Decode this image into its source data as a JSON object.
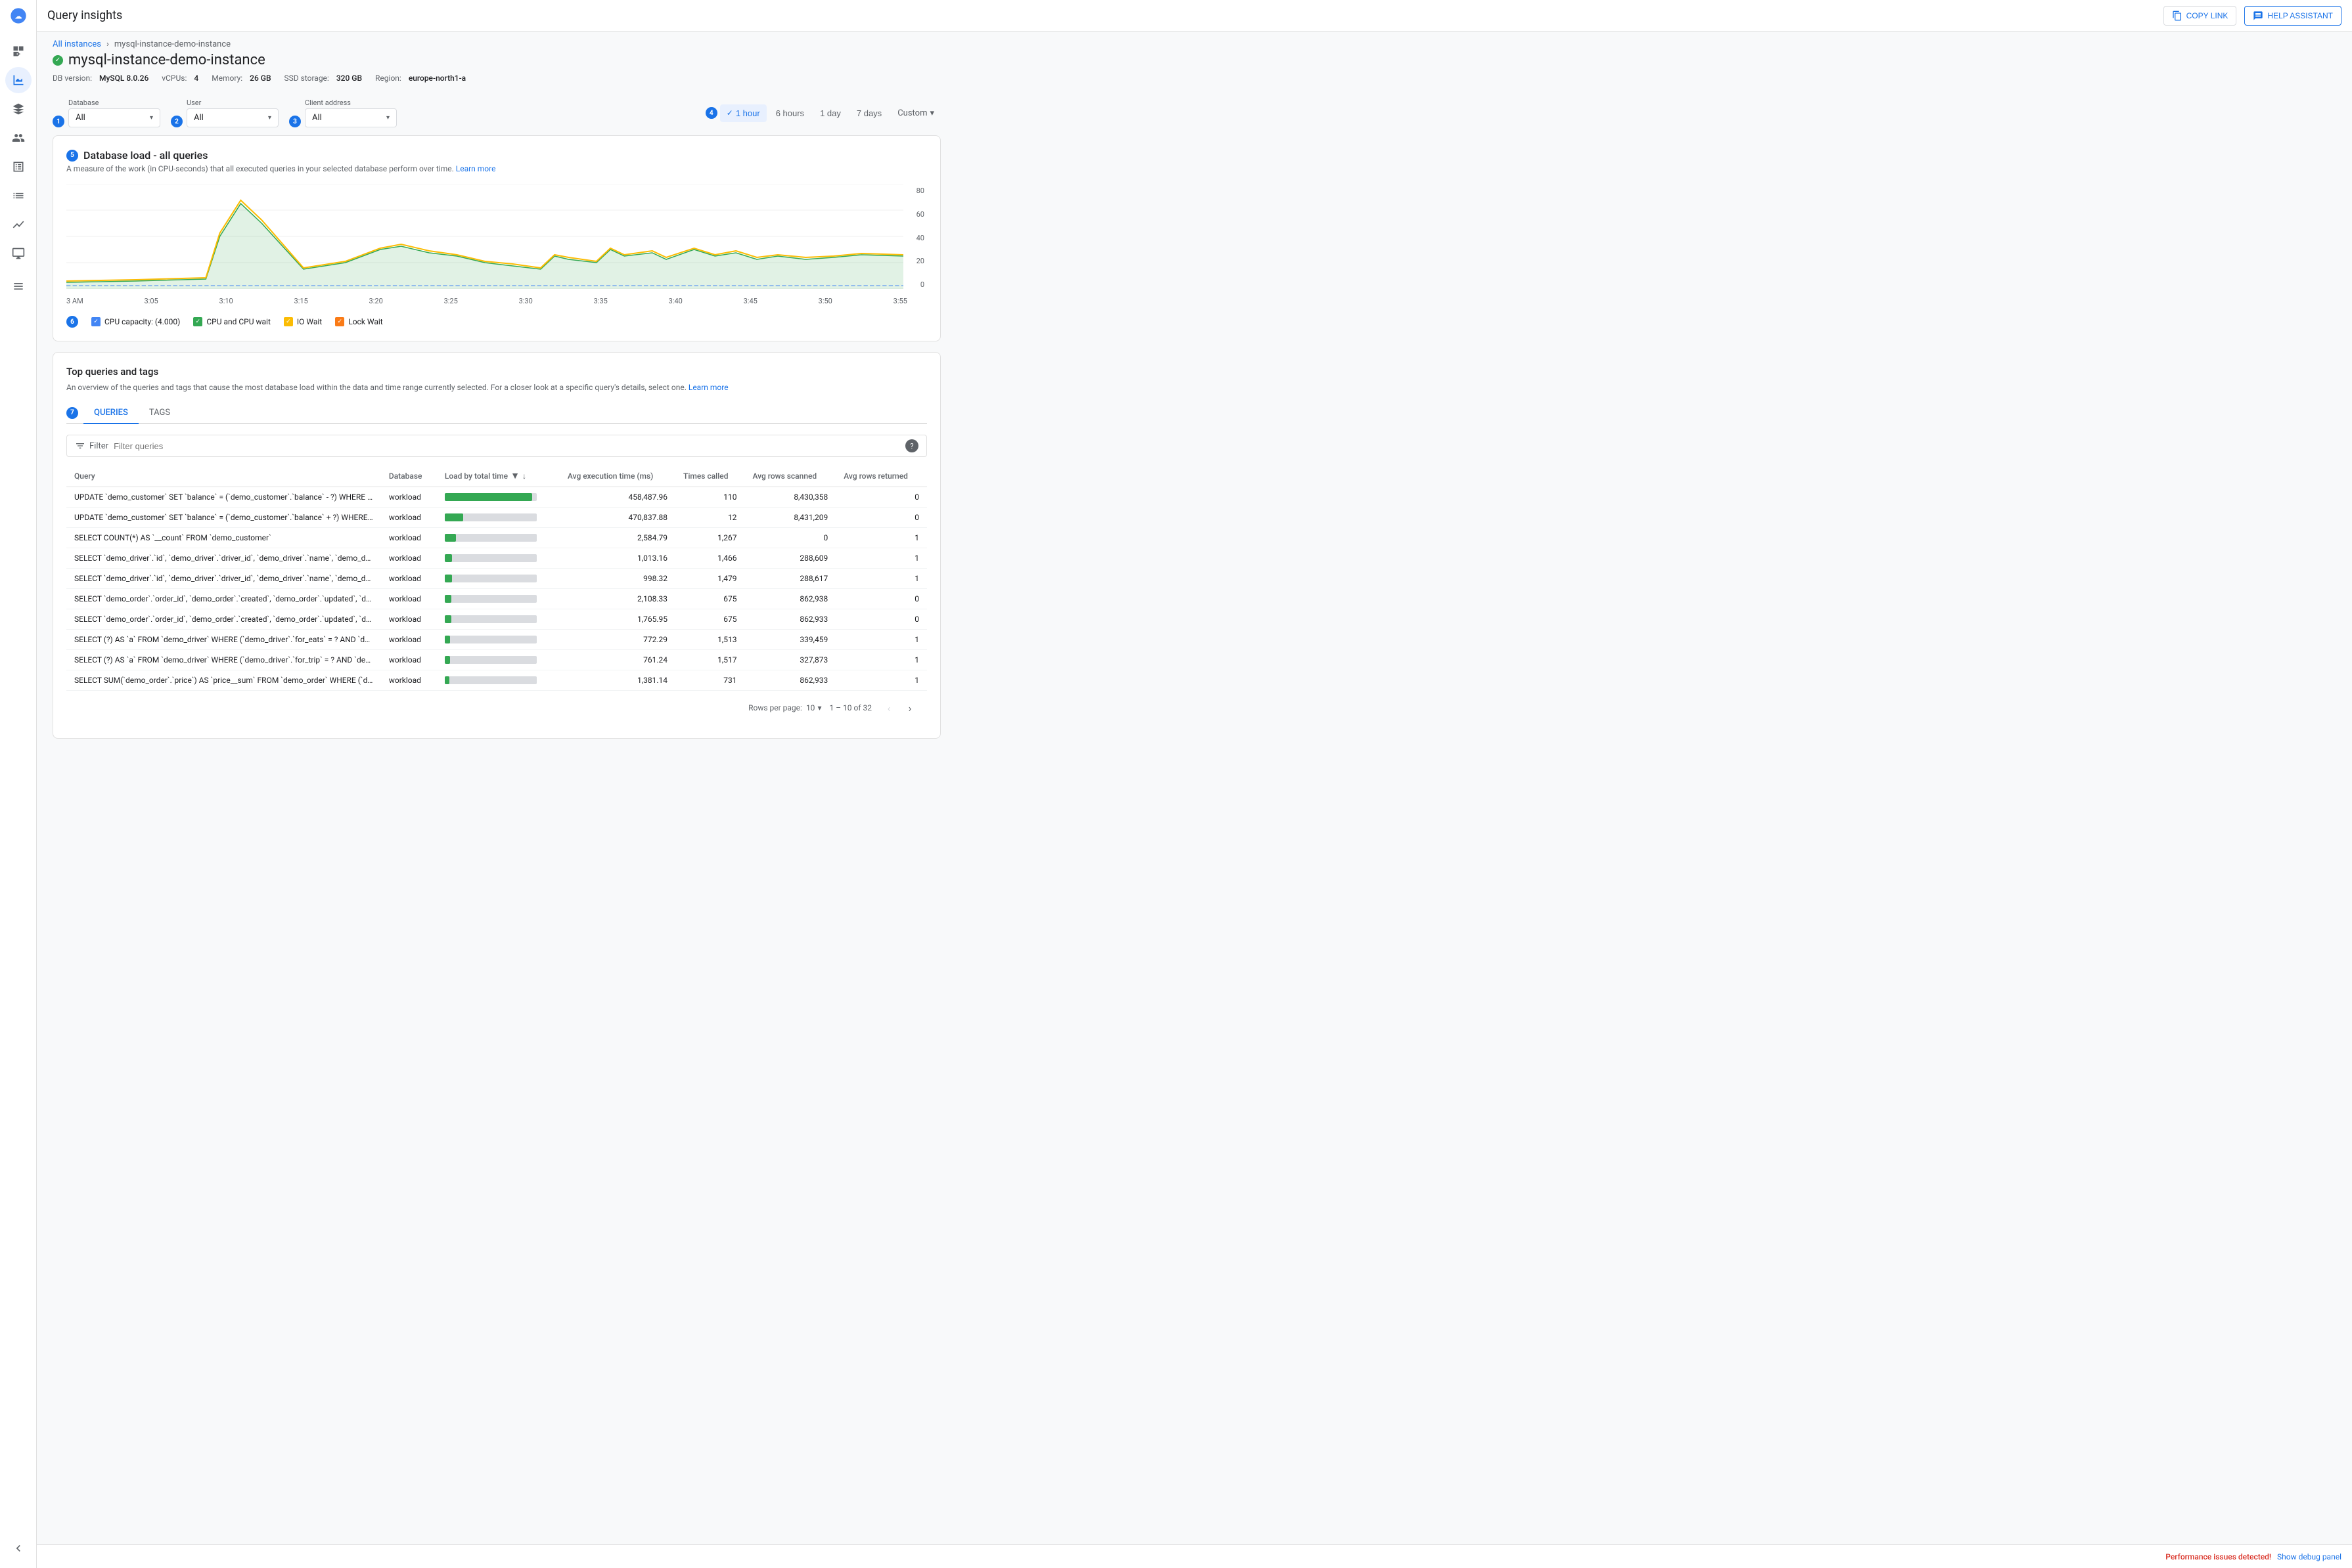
{
  "topbar": {
    "title": "Query insights",
    "copy_link": "COPY LINK",
    "help_assistant": "HELP ASSISTANT"
  },
  "breadcrumb": {
    "all_instances": "All instances",
    "current": "mysql-instance-demo-instance"
  },
  "instance": {
    "name": "mysql-instance-demo-instance",
    "db_version_label": "DB version:",
    "db_version": "MySQL 8.0.26",
    "vcpus_label": "vCPUs:",
    "vcpus": "4",
    "memory_label": "Memory:",
    "memory": "26 GB",
    "ssd_label": "SSD storage:",
    "ssd": "320 GB",
    "region_label": "Region:",
    "region": "europe-north1-a"
  },
  "filters": {
    "database_label": "Database",
    "database_value": "All",
    "user_label": "User",
    "user_value": "All",
    "client_label": "Client address",
    "client_value": "All"
  },
  "time_range": {
    "options": [
      "1 hour",
      "6 hours",
      "1 day",
      "7 days",
      "Custom"
    ],
    "active": "1 hour"
  },
  "chart": {
    "title": "Database load - all queries",
    "desc": "A measure of the work (in CPU-seconds) that all executed queries in your selected database perform over time.",
    "learn_more": "Learn more",
    "y_labels": [
      "80",
      "60",
      "40",
      "20",
      "0"
    ],
    "x_labels": [
      "3 AM",
      "3:05",
      "3:10",
      "3:15",
      "3:20",
      "3:25",
      "3:30",
      "3:35",
      "3:40",
      "3:45",
      "3:50",
      "3:55"
    ],
    "legend": [
      {
        "id": "cpu_capacity",
        "label": "CPU capacity: (4.000)",
        "color": "#4285f4",
        "checked": true,
        "type": "line"
      },
      {
        "id": "cpu_cpu_wait",
        "label": "CPU and CPU wait",
        "color": "#34a853",
        "checked": true,
        "type": "area"
      },
      {
        "id": "io_wait",
        "label": "IO Wait",
        "color": "#fbbc04",
        "checked": true,
        "type": "area"
      },
      {
        "id": "lock_wait",
        "label": "Lock Wait",
        "color": "#fa7b17",
        "checked": true,
        "type": "area"
      }
    ]
  },
  "queries_section": {
    "title": "Top queries and tags",
    "desc": "An overview of the queries and tags that cause the most database load within the data and time range currently selected. For a closer look at a specific query's details, select one.",
    "learn_more": "Learn more",
    "tabs": [
      "QUERIES",
      "TAGS"
    ],
    "active_tab": "QUERIES",
    "filter_placeholder": "Filter queries",
    "filter_label": "Filter",
    "columns": [
      {
        "id": "query",
        "label": "Query"
      },
      {
        "id": "database",
        "label": "Database"
      },
      {
        "id": "load",
        "label": "Load by total time",
        "sortable": true,
        "active_sort": true
      },
      {
        "id": "avg_exec",
        "label": "Avg execution time (ms)"
      },
      {
        "id": "times_called",
        "label": "Times called"
      },
      {
        "id": "avg_rows_scanned",
        "label": "Avg rows scanned"
      },
      {
        "id": "avg_rows_returned",
        "label": "Avg rows returned"
      }
    ],
    "rows": [
      {
        "query": "UPDATE `demo_customer` SET `balance` = (`demo_customer`.`balance` - ?) WHERE `demo_customer`.`name`...",
        "database": "workload",
        "load_pct": 95,
        "avg_exec": "458,487.96",
        "times_called": "110",
        "avg_rows_scanned": "8,430,358",
        "avg_rows_returned": "0"
      },
      {
        "query": "UPDATE `demo_customer` SET `balance` = (`demo_customer`.`balance` + ?) WHERE `demo_customer`.`name`...",
        "database": "workload",
        "load_pct": 20,
        "avg_exec": "470,837.88",
        "times_called": "12",
        "avg_rows_scanned": "8,431,209",
        "avg_rows_returned": "0"
      },
      {
        "query": "SELECT COUNT(*) AS `__count` FROM `demo_customer`",
        "database": "workload",
        "load_pct": 12,
        "avg_exec": "2,584.79",
        "times_called": "1,267",
        "avg_rows_scanned": "0",
        "avg_rows_returned": "1"
      },
      {
        "query": "SELECT `demo_driver`.`id`, `demo_driver`.`driver_id`, `demo_driver`.`name`, `demo_driver`.`address`, `dem`...",
        "database": "workload",
        "load_pct": 8,
        "avg_exec": "1,013.16",
        "times_called": "1,466",
        "avg_rows_scanned": "288,609",
        "avg_rows_returned": "1"
      },
      {
        "query": "SELECT `demo_driver`.`id`, `demo_driver`.`driver_id`, `demo_driver`.`name`, `demo_driver`.`address`, `dem`...",
        "database": "workload",
        "load_pct": 8,
        "avg_exec": "998.32",
        "times_called": "1,479",
        "avg_rows_scanned": "288,617",
        "avg_rows_returned": "1"
      },
      {
        "query": "SELECT `demo_order`.`order_id`, `demo_order`.`created`, `demo_order`.`updated`, `demo_order`.`city`, `de`...",
        "database": "workload",
        "load_pct": 7,
        "avg_exec": "2,108.33",
        "times_called": "675",
        "avg_rows_scanned": "862,938",
        "avg_rows_returned": "0"
      },
      {
        "query": "SELECT `demo_order`.`order_id`, `demo_order`.`created`, `demo_order`.`updated`, `demo_order`.`city`, `de`...",
        "database": "workload",
        "load_pct": 7,
        "avg_exec": "1,765.95",
        "times_called": "675",
        "avg_rows_scanned": "862,933",
        "avg_rows_returned": "0"
      },
      {
        "query": "SELECT (?) AS `a` FROM `demo_driver` WHERE (`demo_driver`.`for_eats` = ? AND `demo_driver`.`current_order`...",
        "database": "workload",
        "load_pct": 6,
        "avg_exec": "772.29",
        "times_called": "1,513",
        "avg_rows_scanned": "339,459",
        "avg_rows_returned": "1"
      },
      {
        "query": "SELECT (?) AS `a` FROM `demo_driver` WHERE (`demo_driver`.`for_trip` = ? AND `demo_driver`.`current_order`...",
        "database": "workload",
        "load_pct": 6,
        "avg_exec": "761.24",
        "times_called": "1,517",
        "avg_rows_scanned": "327,873",
        "avg_rows_returned": "1"
      },
      {
        "query": "SELECT SUM(`demo_order`.`price`) AS `price__sum` FROM `demo_order` WHERE (`demo_order`.`customer_i`...",
        "database": "workload",
        "load_pct": 5,
        "avg_exec": "1,381.14",
        "times_called": "731",
        "avg_rows_scanned": "862,933",
        "avg_rows_returned": "1"
      }
    ],
    "pagination": {
      "rows_per_page_label": "Rows per page:",
      "rows_per_page": "10",
      "range": "1 – 10 of 32"
    }
  },
  "bottom_bar": {
    "alert": "Performance issues detected!",
    "debug_link": "Show debug panel"
  },
  "step_badges": {
    "s1": "1",
    "s2": "2",
    "s3": "3",
    "s4": "4",
    "s5": "5",
    "s6": "6",
    "s7": "7"
  },
  "sidebar": {
    "items": [
      {
        "id": "logo",
        "icon": "☁",
        "label": "Home"
      },
      {
        "id": "dashboard",
        "icon": "⊞",
        "label": "Dashboard"
      },
      {
        "id": "analytics",
        "icon": "📊",
        "label": "Analytics",
        "active": true
      },
      {
        "id": "arrow",
        "icon": "→",
        "label": "Navigate"
      },
      {
        "id": "people",
        "icon": "👥",
        "label": "People"
      },
      {
        "id": "table",
        "icon": "▦",
        "label": "Table"
      },
      {
        "id": "list2",
        "icon": "☰",
        "label": "List"
      },
      {
        "id": "chart2",
        "icon": "📈",
        "label": "Chart"
      },
      {
        "id": "monitor",
        "icon": "🖥",
        "label": "Monitor"
      },
      {
        "id": "terminal",
        "icon": "⌨",
        "label": "Terminal"
      },
      {
        "id": "expand",
        "icon": "⇄",
        "label": "Expand"
      }
    ]
  }
}
